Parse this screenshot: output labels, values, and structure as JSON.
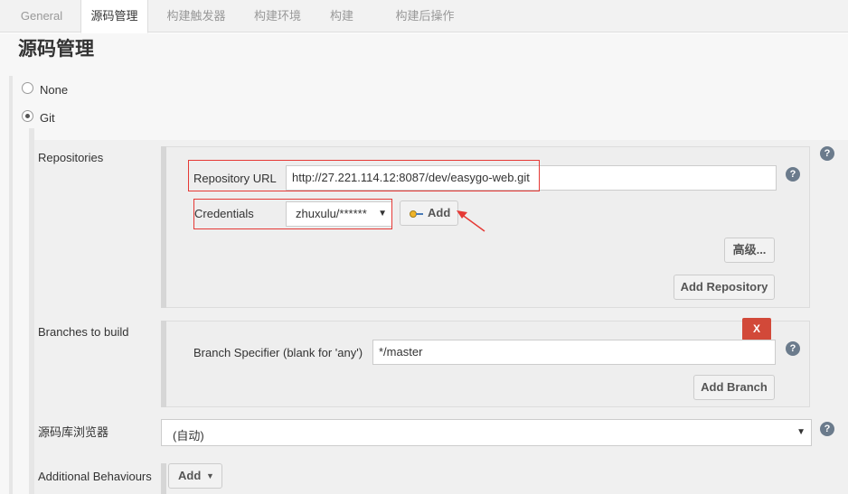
{
  "tabs": [
    {
      "label": "General"
    },
    {
      "label": "源码管理"
    },
    {
      "label": "构建触发器"
    },
    {
      "label": "构建环境"
    },
    {
      "label": "构建"
    },
    {
      "label": "构建后操作"
    }
  ],
  "page_title": "源码管理",
  "scm_options": {
    "none_label": "None",
    "git_label": "Git"
  },
  "repositories": {
    "section_label": "Repositories",
    "url_label": "Repository URL",
    "url_value": "http://27.221.114.12:8087/dev/easygo-web.git",
    "credentials_label": "Credentials",
    "credentials_value": "zhuxulu/******",
    "add_credentials_label": "Add",
    "advanced_label": "高级...",
    "add_repository_label": "Add Repository"
  },
  "branches": {
    "section_label": "Branches to build",
    "delete_label": "X",
    "specifier_label": "Branch Specifier (blank for 'any')",
    "specifier_value": "*/master",
    "add_branch_label": "Add Branch"
  },
  "browser": {
    "section_label": "源码库浏览器",
    "value": "(自动)"
  },
  "behaviours": {
    "section_label": "Additional Behaviours",
    "add_label": "Add"
  },
  "help_glyph": "?",
  "colors": {
    "annotation_red": "#e53935",
    "delete_button": "#d24939",
    "help_icon": "#6b7b8c"
  }
}
